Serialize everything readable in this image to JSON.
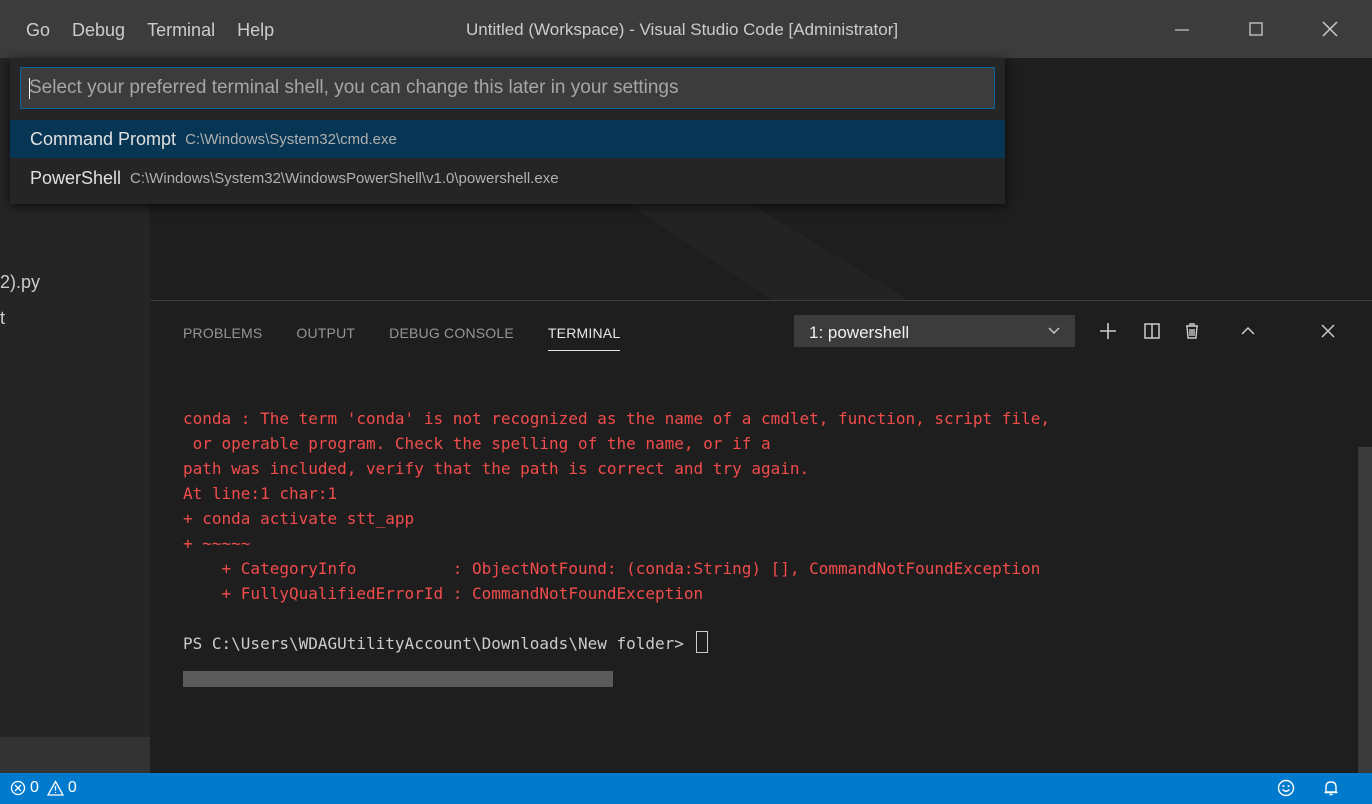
{
  "menu": [
    "Go",
    "Debug",
    "Terminal",
    "Help"
  ],
  "window_title": "Untitled (Workspace) - Visual Studio Code [Administrator]",
  "sidebar": {
    "files": [
      "2).py",
      "t"
    ]
  },
  "panel": {
    "tabs": [
      "PROBLEMS",
      "OUTPUT",
      "DEBUG CONSOLE",
      "TERMINAL"
    ],
    "active_tab": "TERMINAL",
    "terminal_select": "1: powershell"
  },
  "terminal": {
    "error_lines": [
      "conda : The term 'conda' is not recognized as the name of a cmdlet, function, script file,",
      " or operable program. Check the spelling of the name, or if a",
      "path was included, verify that the path is correct and try again.",
      "At line:1 char:1",
      "+ conda activate stt_app",
      "+ ~~~~~",
      "    + CategoryInfo          : ObjectNotFound: (conda:String) [], CommandNotFoundException",
      "    + FullyQualifiedErrorId : CommandNotFoundException"
    ],
    "prompt": "PS C:\\Users\\WDAGUtilityAccount\\Downloads\\New folder> "
  },
  "quick_pick": {
    "placeholder": "Select your preferred terminal shell, you can change this later in your settings",
    "items": [
      {
        "label": "Command Prompt",
        "description": "C:\\Windows\\System32\\cmd.exe",
        "selected": true
      },
      {
        "label": "PowerShell",
        "description": "C:\\Windows\\System32\\WindowsPowerShell\\v1.0\\powershell.exe",
        "selected": false
      }
    ]
  },
  "status_bar": {
    "errors": "0",
    "warnings": "0"
  },
  "colors": {
    "accent": "#007acc",
    "error_text": "#f14c4c",
    "selection": "#073655"
  },
  "icons": [
    "minimize-icon",
    "maximize-icon",
    "close-icon",
    "chevron-down-icon",
    "plus-icon",
    "split-icon",
    "trash-icon",
    "chevron-up-icon",
    "error-icon",
    "warning-icon",
    "smiley-icon",
    "bell-icon"
  ]
}
